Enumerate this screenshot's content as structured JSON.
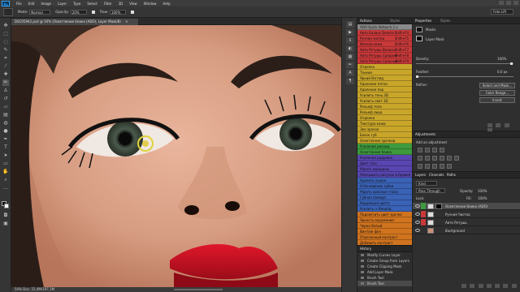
{
  "app": {
    "logo": "Ps",
    "menus": [
      "File",
      "Edit",
      "Image",
      "Layer",
      "Type",
      "Select",
      "Filter",
      "3D",
      "View",
      "Window",
      "Help"
    ]
  },
  "options": {
    "mode_label": "Mode:",
    "mode_value": "Normal",
    "opacity_label": "Opacity:",
    "opacity_value": "20%",
    "flow_label": "Flow:",
    "flow_value": "100%",
    "workspace": "Foto Lift"
  },
  "document": {
    "tab_title": "DSC05942.psd @ 50% (Осветление блика (ADO), Layer Mask/8)",
    "status": "50%   Doc: 22,4M/197,1M"
  },
  "actions_panel": {
    "title": "Actions",
    "tab2": "Styles",
    "colors": {
      "red": "#c9393a",
      "yellow": "#c9a62a",
      "green": "#3d9a3d",
      "violet": "#5a46b0",
      "blue": "#3a62b5",
      "orange": "#d0741f",
      "gray": "#8a8a8a"
    },
    "items": [
      {
        "label": "ADO Quick Retouch 2.x",
        "key": "",
        "color": "gray"
      },
      {
        "label": "Авто Баланс Белого",
        "key": "Shift+F4",
        "color": "red"
      },
      {
        "label": "Ручная чистка",
        "key": "Shift+F5",
        "color": "red"
      },
      {
        "label": "Мягкая кожа",
        "key": "Shift+F6",
        "color": "red"
      },
      {
        "label": "Авто Ретушь Волосы",
        "key": "Shift+F7",
        "color": "red"
      },
      {
        "label": "Авто Ретушь Средний",
        "key": "Shift+F8",
        "color": "red"
      },
      {
        "label": "Авто Ретушь Сильный",
        "key": "Shift+F9",
        "color": "red"
      },
      {
        "label": "Отделка",
        "key": "",
        "color": "yellow"
      },
      {
        "label": "Тонкие",
        "key": "",
        "color": "yellow"
      },
      {
        "label": "Яркий Взгляд",
        "key": "",
        "color": "yellow"
      },
      {
        "label": "Удаление пятен",
        "key": "",
        "color": "yellow"
      },
      {
        "label": "Удаление пор",
        "key": "",
        "color": "yellow"
      },
      {
        "label": "Усилить тень 3D",
        "key": "",
        "color": "yellow"
      },
      {
        "label": "Усилить свет 3D",
        "key": "",
        "color": "yellow"
      },
      {
        "label": "Рельеф тела",
        "key": "",
        "color": "yellow"
      },
      {
        "label": "Рельеф лица",
        "key": "",
        "color": "yellow"
      },
      {
        "label": "Отделка",
        "key": "",
        "color": "yellow"
      },
      {
        "label": "Текстура кожи",
        "key": "",
        "color": "yellow"
      },
      {
        "label": "Эко зрачок",
        "key": "",
        "color": "yellow"
      },
      {
        "label": "Блеск губ",
        "key": "",
        "color": "yellow"
      },
      {
        "label": "Осветление зрачков",
        "key": "",
        "color": "yellow"
      },
      {
        "label": "Усиление ресниц",
        "key": "",
        "color": "green"
      },
      {
        "label": "Осветление блика",
        "key": "",
        "color": "green"
      },
      {
        "label": "Усиление радужки",
        "key": "",
        "color": "violet"
      },
      {
        "label": "Цвет глаз",
        "key": "",
        "color": "violet"
      },
      {
        "label": "Убрать морщины",
        "key": "",
        "color": "violet"
      },
      {
        "label": "Уменьшить рисунок в бровей",
        "key": "",
        "color": "violet"
      },
      {
        "label": "Удалить пушок",
        "key": "",
        "color": "blue"
      },
      {
        "label": "Отбеливание зубов",
        "key": "",
        "color": "blue"
      },
      {
        "label": "Убрать красные глаза",
        "key": "",
        "color": "blue"
      },
      {
        "label": "Губная помада",
        "key": "",
        "color": "blue"
      },
      {
        "label": "Коррекция цвета",
        "key": "",
        "color": "blue"
      },
      {
        "label": "Усилить + Вперёд",
        "key": "",
        "color": "blue"
      },
      {
        "label": "Подсветить цвет зрачка",
        "key": "",
        "color": "orange"
      },
      {
        "label": "Яркость окружения",
        "key": "",
        "color": "orange"
      },
      {
        "label": "Черно белый",
        "key": "",
        "color": "orange"
      },
      {
        "label": "Винтаж фон",
        "key": "",
        "color": "orange"
      },
      {
        "label": "Отрезанный контраст",
        "key": "",
        "color": "orange"
      },
      {
        "label": "Добавить контраст",
        "key": "",
        "color": "orange"
      },
      {
        "label": "Светлые подсветки",
        "key": "",
        "color": "orange"
      },
      {
        "label": "Светлая / Тёмная",
        "key": "",
        "color": "orange"
      },
      {
        "label": "Подготовка к печати (CMYK)",
        "key": "",
        "color": "orange"
      }
    ]
  },
  "history_panel": {
    "title": "History",
    "items": [
      {
        "label": "Modify Curves Layer",
        "selected": false
      },
      {
        "label": "Create Group from Layers",
        "selected": false
      },
      {
        "label": "Create Clipping Mask",
        "selected": false
      },
      {
        "label": "Add Layer Mask",
        "selected": false
      },
      {
        "label": "Brush Tool",
        "selected": false
      },
      {
        "label": "Brush Tool",
        "selected": true
      }
    ]
  },
  "properties_panel": {
    "title": "Properties",
    "tab2": "Styles",
    "masks_label": "Masks",
    "layer_mask_label": "Layer Mask",
    "density_label": "Density:",
    "density_value": "100%",
    "feather_label": "Feather:",
    "feather_value": "0,0 px",
    "refine_label": "Refine:",
    "btn_select": "Select and Mask...",
    "btn_color_range": "Color Range...",
    "btn_invert": "Invert"
  },
  "adjustments_panel": {
    "title": "Adjustments",
    "subtitle": "Add an adjustment"
  },
  "layers_panel": {
    "tab1": "Layers",
    "tab2": "Channels",
    "tab3": "Paths",
    "kind_label": "Kind",
    "blend_mode": "Pass Through",
    "opacity_label": "Opacity:",
    "opacity_value": "100%",
    "lock_label": "Lock:",
    "fill_label": "Fill:",
    "fill_value": "100%",
    "layers": [
      {
        "name": "Осветление блика (ADO)",
        "selected": true,
        "tag": "green"
      },
      {
        "name": "Ручная Чистка",
        "selected": false,
        "tag": "red"
      },
      {
        "name": "Авто Ретушь",
        "selected": false,
        "tag": "red"
      },
      {
        "name": "Background",
        "selected": false,
        "tag": ""
      }
    ]
  }
}
